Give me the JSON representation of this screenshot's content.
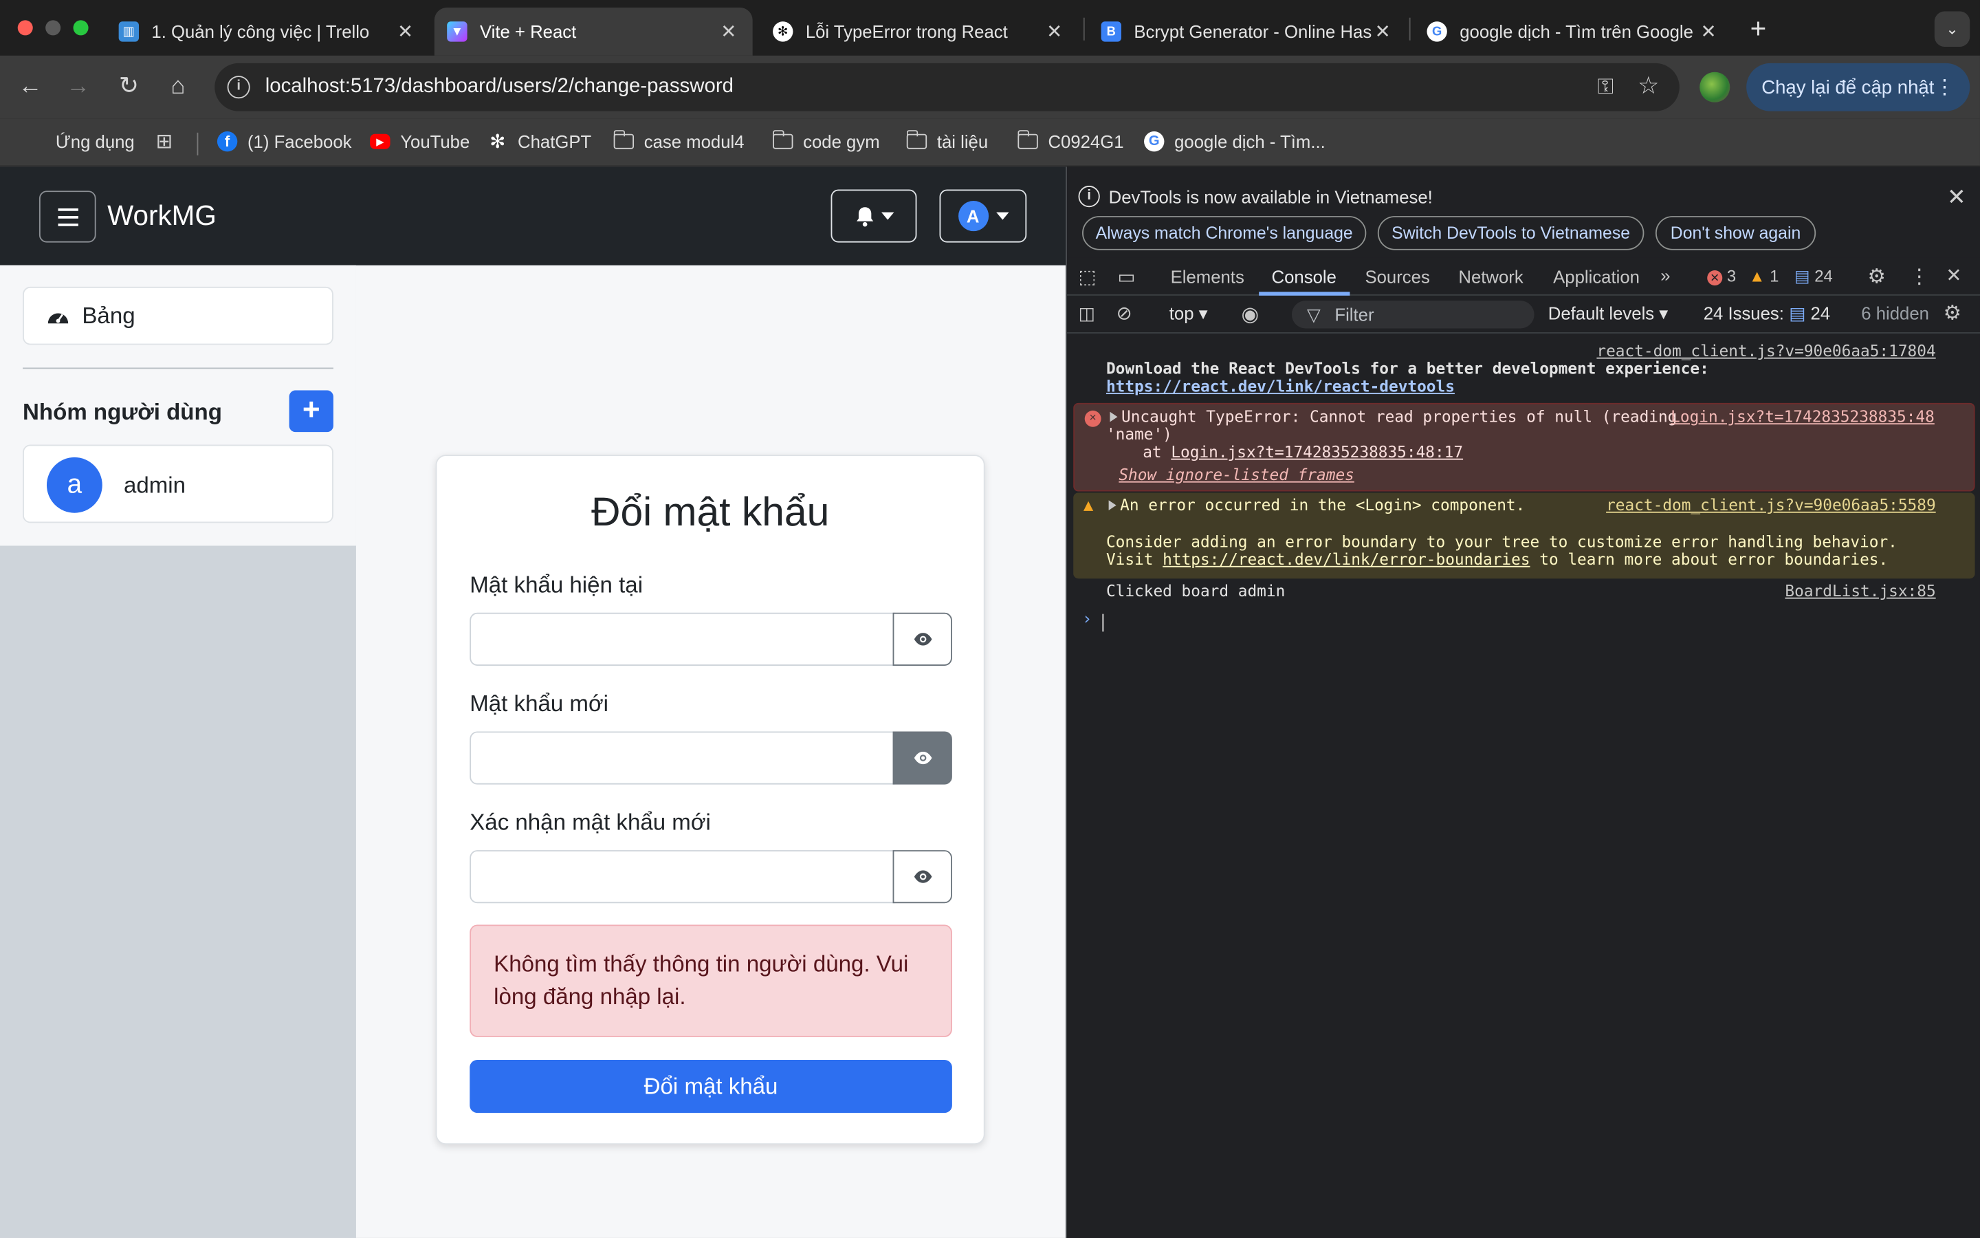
{
  "browser": {
    "tabs": [
      {
        "title": "1. Quản lý công việc | Trello",
        "active": false
      },
      {
        "title": "Vite + React",
        "active": true
      },
      {
        "title": "Lỗi TypeError trong React",
        "active": false
      },
      {
        "title": "Bcrypt Generator - Online Hash",
        "active": false
      },
      {
        "title": "google dịch - Tìm trên Google",
        "active": false
      }
    ],
    "url": "localhost:5173/dashboard/users/2/change-password",
    "update_button": "Chạy lại để cập nhật",
    "bookmarks": [
      {
        "label": "Ứng dụng",
        "icon": "apps-grid-icon"
      },
      {
        "label": "(1) Facebook",
        "icon": "facebook-icon"
      },
      {
        "label": "YouTube",
        "icon": "youtube-icon"
      },
      {
        "label": "ChatGPT",
        "icon": "chatgpt-icon"
      },
      {
        "label": "case modul4",
        "icon": "folder-icon"
      },
      {
        "label": "code gym",
        "icon": "folder-icon"
      },
      {
        "label": "tài liệu",
        "icon": "folder-icon"
      },
      {
        "label": "C0924G1",
        "icon": "folder-icon"
      },
      {
        "label": "google dịch - Tìm...",
        "icon": "google-icon"
      }
    ]
  },
  "app": {
    "brand": "WorkMG",
    "user_initial": "A",
    "sidebar": {
      "board_label": "Bảng",
      "group_title": "Nhóm người dùng",
      "add_label": "+",
      "users": [
        {
          "initial": "a",
          "name": "admin"
        }
      ]
    },
    "form": {
      "title": "Đổi mật khẩu",
      "fields": [
        {
          "label": "Mật khẩu hiện tại",
          "value": "",
          "eye_active": false
        },
        {
          "label": "Mật khẩu mới",
          "value": "",
          "eye_active": true
        },
        {
          "label": "Xác nhận mật khẩu mới",
          "value": "",
          "eye_active": false
        }
      ],
      "alert": "Không tìm thấy thông tin người dùng. Vui lòng đăng nhập lại.",
      "submit_label": "Đổi mật khẩu"
    },
    "colors": {
      "primary": "#2d6ff0",
      "navbar": "#212529",
      "alert_bg": "#f8d7da"
    }
  },
  "devtools": {
    "banner": "DevTools is now available in Vietnamese!",
    "banner_buttons": [
      "Always match Chrome's language",
      "Switch DevTools to Vietnamese",
      "Don't show again"
    ],
    "tabs": [
      "Elements",
      "Console",
      "Sources",
      "Network",
      "Application"
    ],
    "active_tab": "Console",
    "counts": {
      "errors": "3",
      "warnings": "1",
      "messages": "24"
    },
    "context": "top",
    "filter_placeholder": "Filter",
    "levels": "Default levels",
    "issues_label": "24 Issues:",
    "issues_count": "24",
    "hidden": "6 hidden",
    "messages": {
      "m1_source": "react-dom_client.js?v=90e06aa5:17804",
      "m1_text": "Download the React DevTools for a better development experience:",
      "m1_link": "https://react.dev/link/react-devtools",
      "m2_text1": "Uncaught TypeError: Cannot read properties of null (reading",
      "m2_source": "Login.jsx?t=1742835238835:48",
      "m2_text2": "'name')",
      "m2_at": "at ",
      "m2_at_link": "Login.jsx?t=1742835238835:48:17",
      "m2_ignore": "Show ignore-listed frames",
      "m3_text": "An error occurred in the <Login> component.",
      "m3_source": "react-dom_client.js?v=90e06aa5:5589",
      "m3_line2": "Consider adding an error boundary to your tree to customize error handling behavior.",
      "m3_visit": "Visit ",
      "m3_link": "https://react.dev/link/error-boundaries",
      "m3_tail": " to learn more about error boundaries.",
      "m4_text": "Clicked board admin",
      "m4_source": "BoardList.jsx:85"
    }
  }
}
